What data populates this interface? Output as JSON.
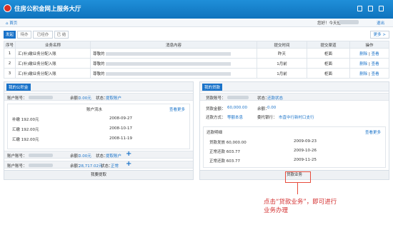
{
  "header": {
    "title": "住房公积金网上服务大厅"
  },
  "subbar": {
    "home": "首页",
    "user": "您好！今天是",
    "tail": "退出",
    "blurred": ""
  },
  "tabs": [
    "发起",
    "待办",
    "已经办",
    "已 结"
  ],
  "more": "更多 >",
  "table": {
    "headers": [
      "序号",
      "业务名称",
      "消息内容",
      "提交时间",
      "提交渠道",
      "操作"
    ],
    "rows": [
      {
        "no": "1",
        "name": "汇(补)缴业务分配入账",
        "msg": "尊敬的",
        "date": "昨天",
        "ch": "柜面",
        "op1": "删除",
        "op2": "查看"
      },
      {
        "no": "2",
        "name": "汇(补)缴业务分配入账",
        "msg": "尊敬的",
        "date": "1月前",
        "ch": "柜面",
        "op1": "删除",
        "op2": "查看"
      },
      {
        "no": "3",
        "name": "汇(补)缴业务分配入账",
        "msg": "尊敬的",
        "date": "1月前",
        "ch": "柜面",
        "op1": "删除",
        "op2": "查看"
      }
    ]
  },
  "left": {
    "tag": "我的公积金",
    "acct_label": "账户账号：",
    "bal_label": "余额：",
    "bal1": "0.00元",
    "state_label": "状态：",
    "state1": "提取账户",
    "detail_title": "账户流水",
    "more": "查看更多",
    "records": [
      {
        "t": "补缴 192.00元",
        "d": "2008-09-27"
      },
      {
        "t": "汇缴 192.00元",
        "d": "2008-10-17"
      },
      {
        "t": "汇缴 192.00元",
        "d": "2008-11-19"
      }
    ],
    "acct2_bal": "0.00元",
    "acct2_state": "提取账户",
    "acct3_bal": "28,717.02元",
    "acct3_state": "正常",
    "bottom": "我要提取"
  },
  "right": {
    "tag": "我的贷款",
    "loan_label": "贷款账号：",
    "state_label": "状态：",
    "state": "还款状态",
    "amount_label": "贷款金额：",
    "amount": "60,000.00",
    "remain_label": "余额：",
    "remain": "0.00",
    "method_label": "还款方式：",
    "method": "等额本息",
    "bank_label": "委托银行：",
    "bank": "市直中行新村口支行",
    "detail_title": "还款明细",
    "more": "查看更多",
    "records": [
      {
        "t": "贷款发放 60,000.00",
        "d": "2009-09-23"
      },
      {
        "t": "正常还款 603.77",
        "d": "2009-10-26"
      },
      {
        "t": "正常还款 603.77",
        "d": "2009-11-25"
      }
    ],
    "bottom": "贷款业务"
  },
  "callout": "点击“贷款业务”，即可进行业务办理"
}
